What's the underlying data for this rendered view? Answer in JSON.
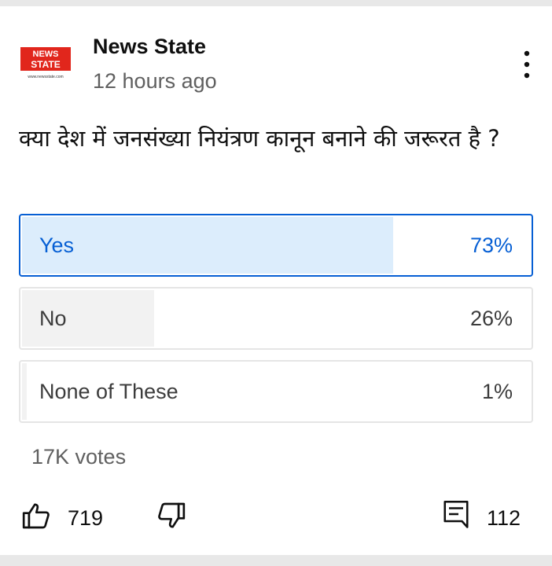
{
  "post": {
    "logo_text_top": "NEWS",
    "logo_text_bottom": "STATE",
    "logo_url_text": "www.newsstate.com",
    "channel_name": "News State",
    "timestamp": "12 hours ago",
    "question": "क्या देश में जनसंख्या नियंत्रण कानून बनाने की जरूरत है ?"
  },
  "poll": {
    "options": [
      {
        "label": "Yes",
        "percent_text": "73%",
        "percent": 73,
        "selected": true
      },
      {
        "label": "No",
        "percent_text": "26%",
        "percent": 26,
        "selected": false
      },
      {
        "label": "None of These",
        "percent_text": "1%",
        "percent": 1,
        "selected": false
      }
    ],
    "votes": "17K votes"
  },
  "actions": {
    "like_count": "719",
    "comment_count": "112"
  },
  "colors": {
    "accent": "#065fd4",
    "selected_fill": "#dcedfc",
    "unselected_fill": "#f2f2f2",
    "logo_red": "#e1261c"
  },
  "icons": {
    "menu": "more-vert-icon",
    "like": "thumb-up-outline-icon",
    "dislike": "thumb-down-outline-icon",
    "comment": "comment-icon"
  }
}
